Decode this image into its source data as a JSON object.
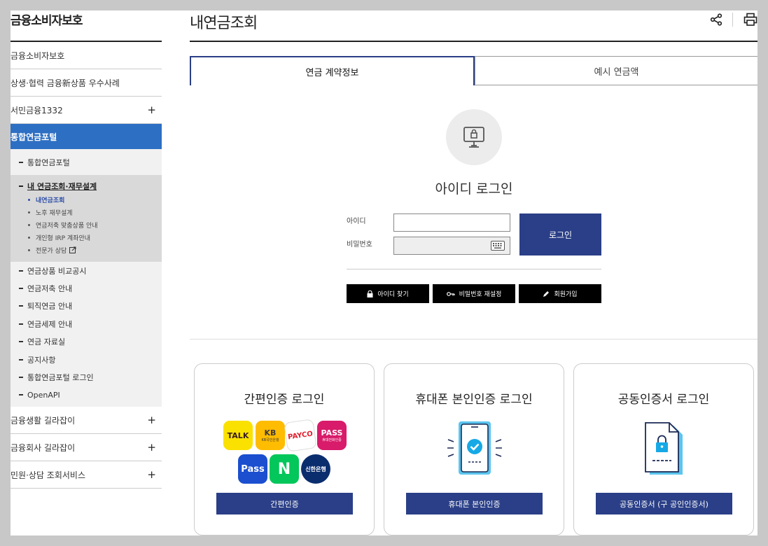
{
  "sidebar": {
    "title": "금융소비자보호",
    "top_items": [
      {
        "label": "금융소비자보호"
      },
      {
        "label": "상생·협력 금융新상품 우수사례"
      },
      {
        "label": "서민금융1332",
        "toggle": "+"
      }
    ],
    "active_section": "통합연금포털",
    "portal_home": "통합연금포털",
    "group": {
      "label": "내 연금조회·재무설계",
      "leaves": [
        "내연금조회",
        "노후 재무설계",
        "연금저축 맞춤상품 안내",
        "개인형 IRP 계좌안내",
        "전문가 상담"
      ]
    },
    "sub_items": [
      "연금상품 비교공시",
      "연금저축 안내",
      "퇴직연금 안내",
      "연금세제 안내",
      "연금 자료실",
      "공지사항",
      "통합연금포털 로그인",
      "OpenAPI"
    ],
    "bottom_items": [
      {
        "label": "금융생활 길라잡이",
        "toggle": "+"
      },
      {
        "label": "금융회사 길라잡이",
        "toggle": "+"
      },
      {
        "label": "민원·상담 조회서비스",
        "toggle": "+"
      }
    ]
  },
  "main": {
    "title": "내연금조회",
    "icons": [
      "share-icon",
      "print-icon"
    ],
    "tabs": [
      {
        "label": "연금 계약정보",
        "active": true
      },
      {
        "label": "예시 연금액",
        "active": false
      }
    ],
    "login": {
      "title": "아이디 로그인",
      "id_label": "아이디",
      "pw_label": "비밀번호",
      "id_value": "",
      "pw_value": "",
      "submit": "로그인",
      "find_id": "아이디 찾기",
      "reset_pw": "비밀번호 재설정",
      "signup": "회원가입"
    },
    "cards": [
      {
        "title": "간편인증 로그인",
        "button": "간편인증",
        "logos": [
          {
            "name": "kakao-logo",
            "text": "TALK",
            "bg": "#fae100",
            "fg": "#3a1d1d"
          },
          {
            "name": "kb-logo",
            "text": "KB",
            "sub": "KB국민은행",
            "bg": "#ffbc00",
            "fg": "#3a3a3a"
          },
          {
            "name": "payco-logo",
            "text": "PAYCO",
            "bg": "#ffffff",
            "fg": "#e0202e"
          },
          {
            "name": "pass-logo",
            "text": "PASS",
            "sub": "휴대전화인증",
            "bg": "#d81b6a",
            "fg": "#ffffff"
          },
          {
            "name": "samsung-pass-logo",
            "text": "Pass",
            "bg": "#1b4fcf",
            "fg": "#ffffff"
          },
          {
            "name": "naver-logo",
            "text": "N",
            "bg": "#03c75a",
            "fg": "#ffffff"
          },
          {
            "name": "shinhan-logo",
            "text": "신한은행",
            "bg": "#0a2d6e",
            "fg": "#ffffff"
          }
        ]
      },
      {
        "title": "휴대폰 본인인증 로그인",
        "button": "휴대폰 본인인증"
      },
      {
        "title": "공동인증서 로그인",
        "button": "공동인증서 (구 공인인증서)"
      }
    ]
  },
  "colors": {
    "accent": "#2a3f87",
    "active_menu": "#2d6fc3"
  }
}
